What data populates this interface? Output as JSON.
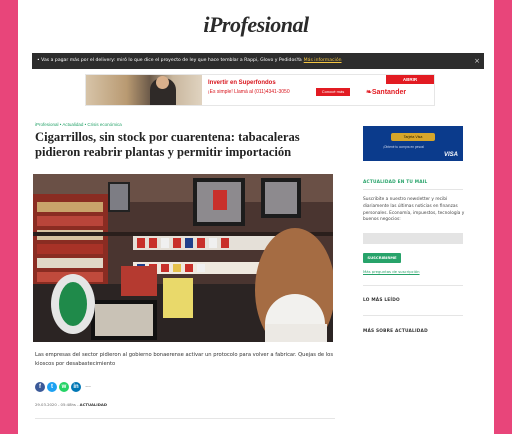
{
  "site": {
    "logo_text": "iProfesional"
  },
  "alert": {
    "text": "• Vas a pagar más por el delivery: miró lo que dice el proyecto de ley que hace temblar a Rappi, Glovo y PedidosYa",
    "link_label": "Más información",
    "close_label": "×"
  },
  "ad": {
    "headline": "Invertir en Superfondos",
    "subline": "¡Es simple! Llamá al (011)4341-3050",
    "button_label": "Conocé más",
    "open_label": "ABRIR",
    "brand": "Santander"
  },
  "article": {
    "breadcrumb": "iProfesional • Actualidad • Crisis económica",
    "title": "Cigarrillos, sin stock por cuarentena: tabacaleras pidieron reabrir plantas y permitir importación",
    "summary": "Las empresas del sector pidieron al gobierno bonaerense activar un protocolo para volver a fabricar. Quejas de los kioscos por desabastecimiento",
    "date": "29.03.2020",
    "time": "05:48hs",
    "section": "ACTUALIDAD",
    "share": [
      {
        "name": "facebook",
        "glyph": "f",
        "color": "#3b5998"
      },
      {
        "name": "twitter",
        "glyph": "t",
        "color": "#1da1f2"
      },
      {
        "name": "whatsapp",
        "glyph": "w",
        "color": "#25d366"
      },
      {
        "name": "linkedin",
        "glyph": "in",
        "color": "#0077b5"
      }
    ],
    "more_label": "..."
  },
  "sidebar": {
    "card_chip": "Tarjeta Visa",
    "card_sub": "¡Obtené tu compra en pesos!",
    "card_brand": "VISA",
    "newsletter_title": "ACTUALIDAD EN TU MAIL",
    "newsletter_desc": "Suscribite a nuestro newsletter y recibí diariamente las últimas noticias en finanzas personales. Economía, impuestos, tecnología y buenos negocios:",
    "subscribe_label": "SUSCRIBIRME",
    "privacy_link": "Más preguntas de suscripción",
    "most_read": "LO MÁS LEÍDO",
    "more_news": "MÁS SOBRE ACTUALIDAD"
  }
}
